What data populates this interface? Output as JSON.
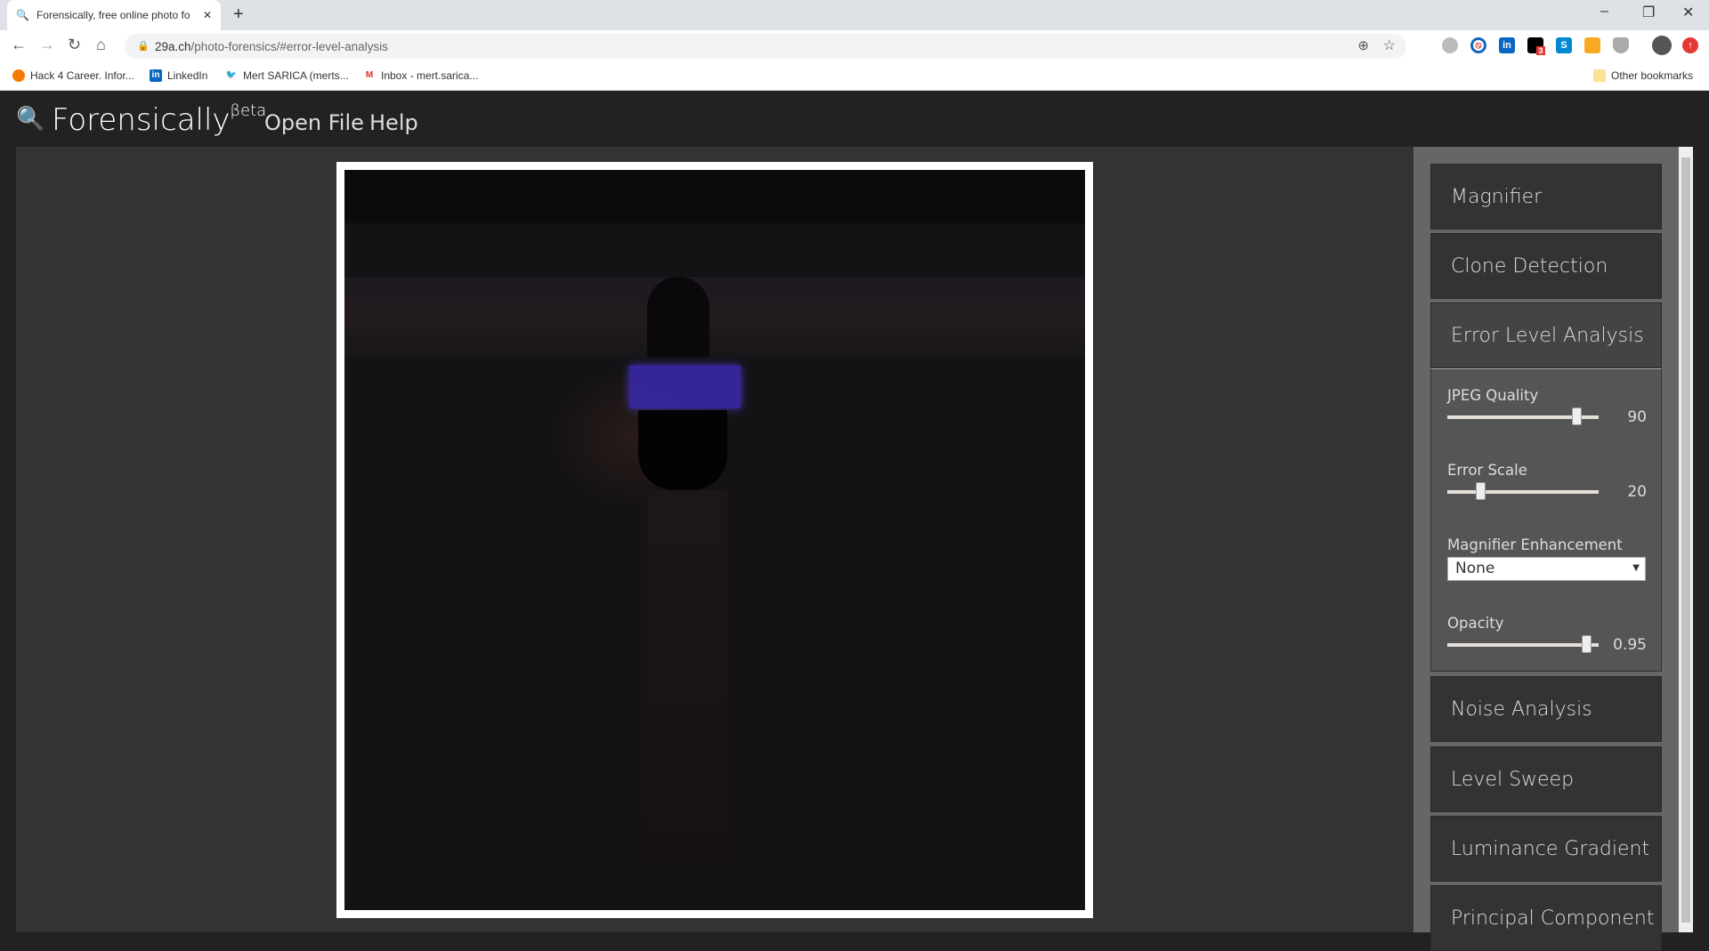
{
  "browser": {
    "tab_title": "Forensically, free online photo fo",
    "url_host": "29a.ch",
    "url_path": "/photo-forensics/#error-level-analysis",
    "bookmarks": [
      {
        "label": "Hack 4 Career. Infor...",
        "icon": "hack4career-icon",
        "color": "#f57c00"
      },
      {
        "label": "LinkedIn",
        "icon": "linkedin-icon",
        "color": "#0a66c2"
      },
      {
        "label": "Mert SARICA (merts...",
        "icon": "twitter-icon",
        "color": "#1da1f2"
      },
      {
        "label": "Inbox - mert.sarica...",
        "icon": "gmail-icon",
        "color": "#d93025"
      }
    ],
    "other_bookmarks": "Other bookmarks",
    "extension_badge": "3"
  },
  "app": {
    "logo": "Forensically",
    "logo_sup": "Beta",
    "menu": [
      "Open File",
      "Help"
    ]
  },
  "sidebar": {
    "tools": [
      "Magnifier",
      "Clone Detection",
      "Error Level Analysis",
      "Noise Analysis",
      "Level Sweep",
      "Luminance Gradient",
      "Principal Component"
    ],
    "active_tool": "Error Level Analysis",
    "ela": {
      "jpeg_quality_label": "JPEG Quality",
      "jpeg_quality": "90",
      "jpeg_quality_fraction": 0.88,
      "error_scale_label": "Error Scale",
      "error_scale": "20",
      "error_scale_fraction": 0.2,
      "magnifier_label": "Magnifier Enhancement",
      "magnifier_value": "None",
      "opacity_label": "Opacity",
      "opacity": "0.95",
      "opacity_fraction": 0.95
    }
  }
}
